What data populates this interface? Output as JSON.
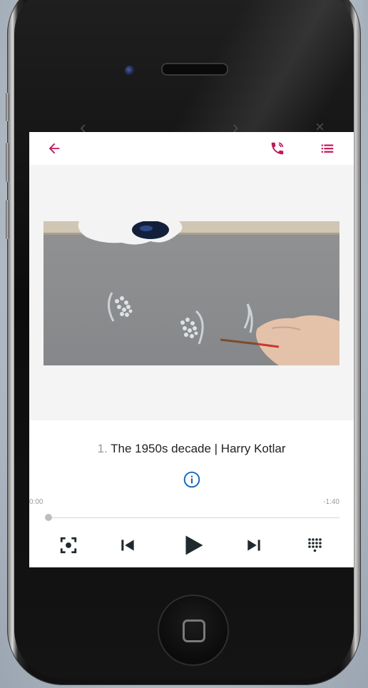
{
  "app_bar": {
    "back_icon": "arrow-left-icon",
    "call_icon": "phone-call-icon",
    "playlist_icon": "list-icon",
    "accent_color": "#c2185b"
  },
  "track": {
    "number": "1.",
    "title": "The 1950s decade | Harry Kotlar",
    "info_icon": "info-circle-icon",
    "info_color": "#1565c0"
  },
  "progress": {
    "elapsed": "0:00",
    "remaining": "-1:40",
    "fraction": 0.0
  },
  "controls": {
    "fullscreen_icon": "focus-frame-icon",
    "previous_icon": "skip-previous-icon",
    "play_icon": "play-icon",
    "next_icon": "skip-next-icon",
    "keypad_icon": "dial-pad-icon"
  }
}
